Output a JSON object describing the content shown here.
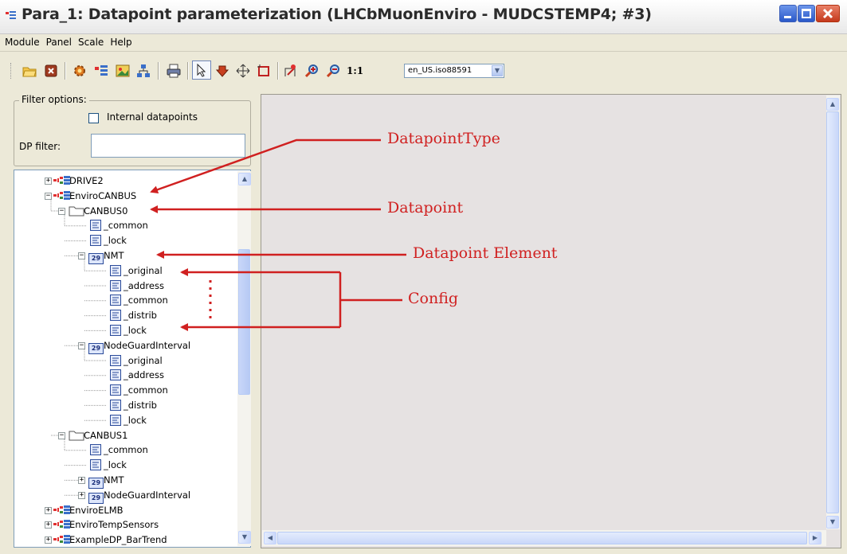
{
  "window": {
    "title": "Para_1: Datapoint parameterization (LHCbMuonEnviro - MUDCSTEMP4; #3)",
    "controls": [
      "minimize",
      "maximize",
      "close"
    ]
  },
  "menu": [
    "Module",
    "Panel",
    "Scale",
    "Help"
  ],
  "toolbar": {
    "zoom_1to1": "1:1",
    "language_select": "en_US.iso88591"
  },
  "filter": {
    "legend": "Filter options:",
    "internal_label": "Internal datapoints",
    "internal_checked": false,
    "dp_filter_label": "DP filter:",
    "dp_filter_value": ""
  },
  "tree": [
    {
      "label": "DRIVE2",
      "kind": "dptype",
      "level": 0,
      "expander": "+"
    },
    {
      "label": "EnviroCANBUS",
      "kind": "dptype",
      "level": 0,
      "expander": "-"
    },
    {
      "label": "CANBUS0",
      "kind": "folder",
      "level": 1,
      "expander": "-"
    },
    {
      "label": "_common",
      "kind": "config",
      "level": 2,
      "expander": ""
    },
    {
      "label": "_lock",
      "kind": "config",
      "level": 2,
      "expander": ""
    },
    {
      "label": "NMT",
      "kind": "element",
      "level": 2,
      "expander": "-"
    },
    {
      "label": "_original",
      "kind": "config",
      "level": 3,
      "expander": ""
    },
    {
      "label": "_address",
      "kind": "config",
      "level": 3,
      "expander": ""
    },
    {
      "label": "_common",
      "kind": "config",
      "level": 3,
      "expander": ""
    },
    {
      "label": "_distrib",
      "kind": "config",
      "level": 3,
      "expander": ""
    },
    {
      "label": "_lock",
      "kind": "config",
      "level": 3,
      "expander": ""
    },
    {
      "label": "NodeGuardInterval",
      "kind": "element",
      "level": 2,
      "expander": "-"
    },
    {
      "label": "_original",
      "kind": "config",
      "level": 3,
      "expander": ""
    },
    {
      "label": "_address",
      "kind": "config",
      "level": 3,
      "expander": ""
    },
    {
      "label": "_common",
      "kind": "config",
      "level": 3,
      "expander": ""
    },
    {
      "label": "_distrib",
      "kind": "config",
      "level": 3,
      "expander": ""
    },
    {
      "label": "_lock",
      "kind": "config",
      "level": 3,
      "expander": ""
    },
    {
      "label": "CANBUS1",
      "kind": "folder",
      "level": 1,
      "expander": "-"
    },
    {
      "label": "_common",
      "kind": "config",
      "level": 2,
      "expander": ""
    },
    {
      "label": "_lock",
      "kind": "config",
      "level": 2,
      "expander": ""
    },
    {
      "label": "NMT",
      "kind": "element",
      "level": 2,
      "expander": "+"
    },
    {
      "label": "NodeGuardInterval",
      "kind": "element",
      "level": 2,
      "expander": "+"
    },
    {
      "label": "EnviroELMB",
      "kind": "dptype",
      "level": 0,
      "expander": "+"
    },
    {
      "label": "EnviroTempSensors",
      "kind": "dptype",
      "level": 0,
      "expander": "+"
    },
    {
      "label": "ExampleDP_BarTrend",
      "kind": "dptype",
      "level": 0,
      "expander": "+"
    }
  ],
  "element_badge": "29",
  "annotations": {
    "datapoint_type": "DatapointType",
    "datapoint": "Datapoint",
    "datapoint_element": "Datapoint Element",
    "config": "Config",
    "color": "#d02020"
  }
}
